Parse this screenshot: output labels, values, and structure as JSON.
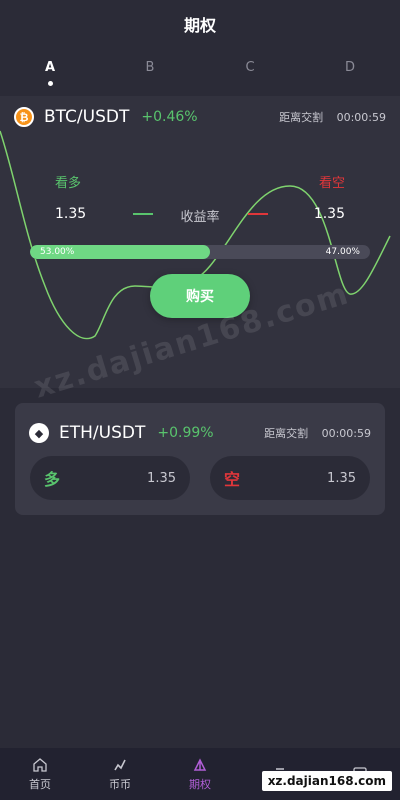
{
  "header": {
    "title": "期权"
  },
  "tabs": [
    {
      "label": "A",
      "active": true
    },
    {
      "label": "B",
      "active": false
    },
    {
      "label": "C",
      "active": false
    },
    {
      "label": "D",
      "active": false
    }
  ],
  "main_card": {
    "pair": "BTC/USDT",
    "change": "+0.46%",
    "deadline_label": "距离交割",
    "deadline_time": "00:00:59",
    "coin_icon": "bitcoin-icon",
    "long_label": "看多",
    "short_label": "看空",
    "left_value": "1.35",
    "right_value": "1.35",
    "rate_label": "收益率",
    "long_percent": 53.0,
    "long_percent_text": "53.00%",
    "short_percent_text": "47.00%",
    "buy_label": "购买"
  },
  "second_card": {
    "pair": "ETH/USDT",
    "change": "+0.99%",
    "deadline_label": "距离交割",
    "deadline_time": "00:00:59",
    "coin_icon": "ethereum-icon",
    "long_label": "多",
    "long_value": "1.35",
    "short_label": "空",
    "short_value": "1.35"
  },
  "watermark": "xz.dajian168.com",
  "corner_watermark": "xz.dajian168.com",
  "bottom_nav": [
    {
      "label": "首页",
      "icon": "home-icon",
      "active": false
    },
    {
      "label": "币币",
      "icon": "trade-icon",
      "active": false
    },
    {
      "label": "期权",
      "icon": "options-icon",
      "active": true
    },
    {
      "label": "",
      "icon": "list-icon",
      "active": false
    },
    {
      "label": "",
      "icon": "wallet-icon",
      "active": false
    }
  ],
  "colors": {
    "background": "#2b2b37",
    "card": "#32323e",
    "up": "#59c46d",
    "down": "#e0363a",
    "nav_active": "#b05ed6"
  }
}
